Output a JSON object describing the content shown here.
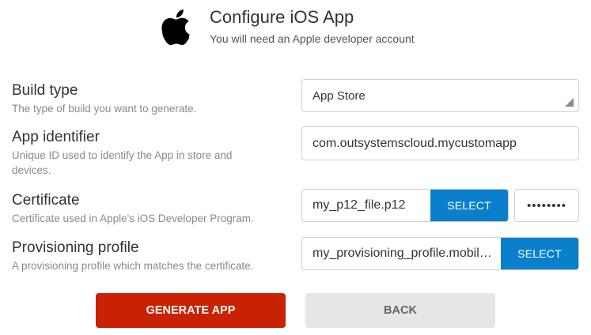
{
  "header": {
    "title": "Configure iOS App",
    "subtitle": "You will need an Apple developer account",
    "logo_icon": "apple-logo-icon"
  },
  "build_type": {
    "label": "Build type",
    "description": "The type of build you want to generate.",
    "value": "App Store"
  },
  "app_identifier": {
    "label": "App identifier",
    "description": "Unique ID used to identify the App in store and devices.",
    "value": "com.outsystemscloud.mycustomapp"
  },
  "certificate": {
    "label": "Certificate",
    "description": "Certificate used in Apple's iOS Developer Program.",
    "file_name": "my_p12_file.p12",
    "select_label": "SELECT",
    "password_mask": "••••••••"
  },
  "provisioning": {
    "label": "Provisioning profile",
    "description": "A provisioning profile which matches the certificate.",
    "file_name": "my_provisioning_profile.mobileprovision",
    "select_label": "SELECT"
  },
  "actions": {
    "generate_label": "GENERATE APP",
    "back_label": "BACK"
  },
  "colors": {
    "primary_blue": "#0a80cd",
    "generate_red": "#c82103",
    "back_gray": "#e6e6e6"
  }
}
